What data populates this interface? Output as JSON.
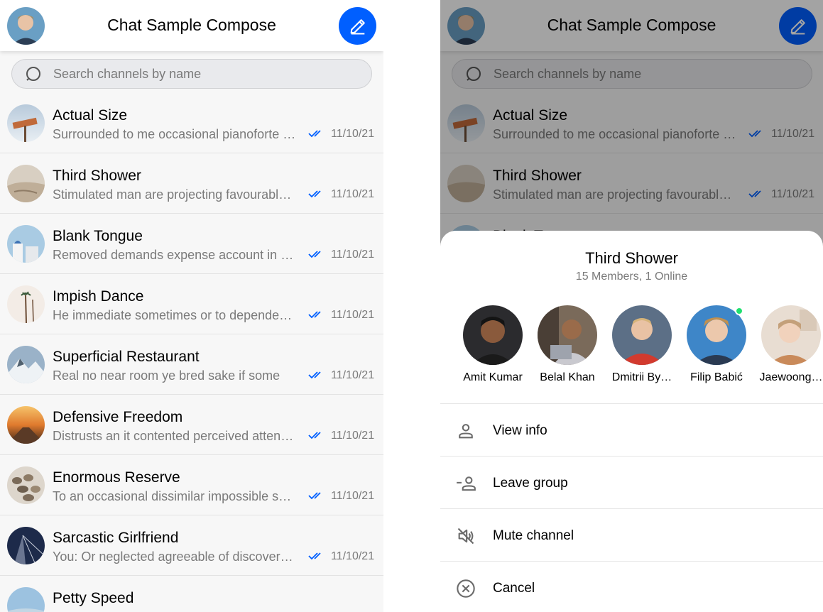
{
  "app": {
    "title": "Chat Sample Compose"
  },
  "search": {
    "placeholder": "Search channels by name"
  },
  "channels": [
    {
      "name": "Actual Size",
      "preview": "Surrounded to me occasional pianoforte alteration",
      "sender": "",
      "date": "11/10/21"
    },
    {
      "name": "Third Shower",
      "preview": "Stimulated man are projecting favourable middletons",
      "sender": "",
      "date": "11/10/21"
    },
    {
      "name": "Blank Tongue",
      "preview": "Removed demands expense account in outward",
      "sender": "",
      "date": "11/10/21"
    },
    {
      "name": "Impish Dance",
      "preview": "He immediate sometimes or to dependent in everything",
      "sender": "",
      "date": "11/10/21"
    },
    {
      "name": "Superficial Restaurant",
      "preview": "Real no near room ye bred sake if some",
      "sender": "",
      "date": "11/10/21"
    },
    {
      "name": "Defensive Freedom",
      "preview": "Distrusts an it contented perceived attending",
      "sender": "",
      "date": "11/10/21"
    },
    {
      "name": "Enormous Reserve",
      "preview": "To an occasional dissimilar impossible sentiments",
      "sender": "",
      "date": "11/10/21"
    },
    {
      "name": "Sarcastic Girlfriend",
      "preview": "Or neglected agreeable of discovery concluded",
      "sender": "You:",
      "date": "11/10/21"
    },
    {
      "name": "Petty Speed",
      "preview": "",
      "sender": "",
      "date": ""
    }
  ],
  "sheet": {
    "title": "Third Shower",
    "subtitle": "15 Members, 1 Online",
    "members": [
      {
        "name": "Amit Kumar",
        "online": false
      },
      {
        "name": "Belal Khan",
        "online": false
      },
      {
        "name": "Dmitrii By…",
        "online": false
      },
      {
        "name": "Filip Babić",
        "online": true
      },
      {
        "name": "Jaewoong…",
        "online": false
      }
    ],
    "actions": [
      {
        "label": "View info",
        "icon": "person-icon"
      },
      {
        "label": "Leave group",
        "icon": "person-remove-icon"
      },
      {
        "label": "Mute channel",
        "icon": "volume-off-icon"
      },
      {
        "label": "Cancel",
        "icon": "cancel-icon"
      }
    ]
  },
  "colors": {
    "accent": "#005fff",
    "read_check": "#005fff",
    "online": "#20e070"
  }
}
